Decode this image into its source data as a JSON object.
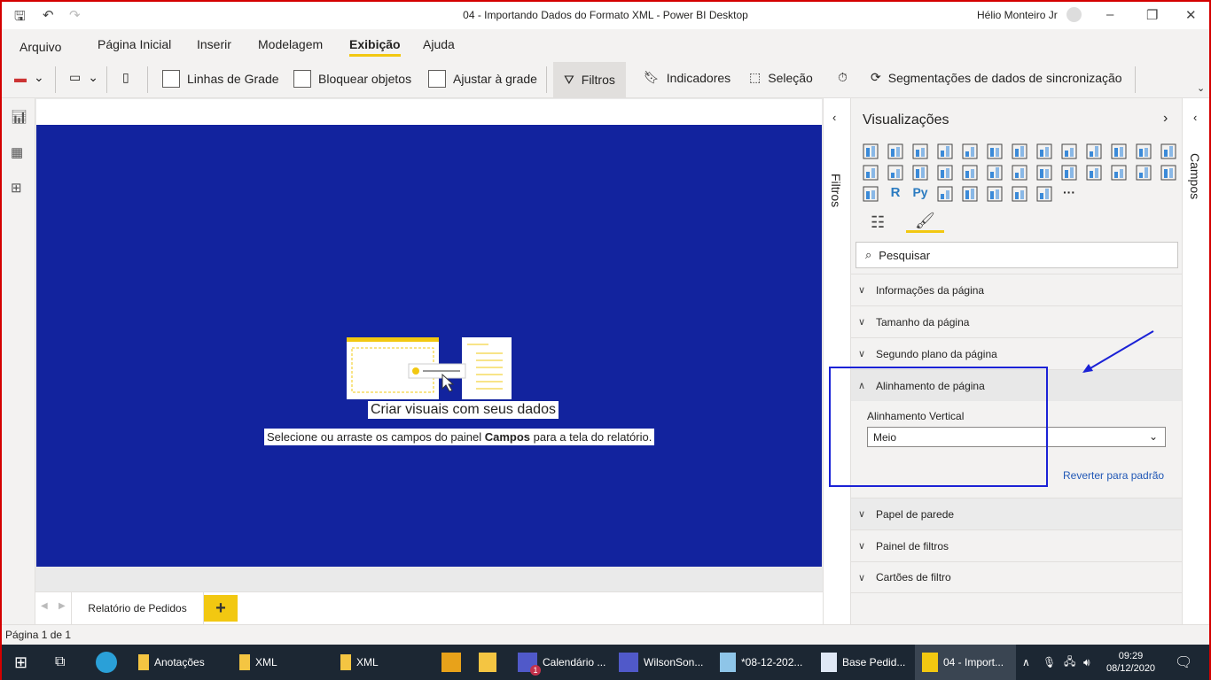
{
  "window": {
    "title": "04 - Importando Dados do Formato XML - Power BI Desktop",
    "user": "Hélio Monteiro Jr"
  },
  "menu": [
    "Arquivo",
    "Página Inicial",
    "Inserir",
    "Modelagem",
    "Exibição",
    "Ajuda"
  ],
  "ribbon": {
    "grid_lines": "Linhas de Grade",
    "lock_objects": "Bloquear objetos",
    "snap_grid": "Ajustar à grade",
    "filters": "Filtros",
    "bookmarks": "Indicadores",
    "selection": "Seleção",
    "sync_slicers": "Segmentações de dados de sincronização"
  },
  "canvas": {
    "title": "Criar visuais com seus dados",
    "subtitle_pre": "Selecione ou arraste os campos do painel ",
    "subtitle_bold": "Campos",
    "subtitle_post": " para a tela do relatório.",
    "background": "#12239e"
  },
  "page_tabs": [
    "Relatório de Pedidos"
  ],
  "filters_pane": {
    "label": "Filtros"
  },
  "visualizations": {
    "title": "Visualizações",
    "search_placeholder": "Pesquisar",
    "sections": [
      "Informações da página",
      "Tamanho da página",
      "Segundo plano da página",
      "Alinhamento de página",
      "Papel de parede",
      "Painel de filtros",
      "Cartões de filtro"
    ],
    "alignment": {
      "label": "Alinhamento Vertical",
      "value": "Meio",
      "reset": "Reverter para padrão"
    }
  },
  "fields_pane": {
    "label": "Campos"
  },
  "status": "Página 1 de 1",
  "taskbar": {
    "items": [
      "Anotações",
      "XML",
      "XML",
      "Calendário ...",
      "WilsonSon...",
      "*08-12-202...",
      "Base Pedid...",
      "04 - Import..."
    ],
    "time": "09:29",
    "date": "08/12/2020",
    "teams_badge": "1"
  }
}
